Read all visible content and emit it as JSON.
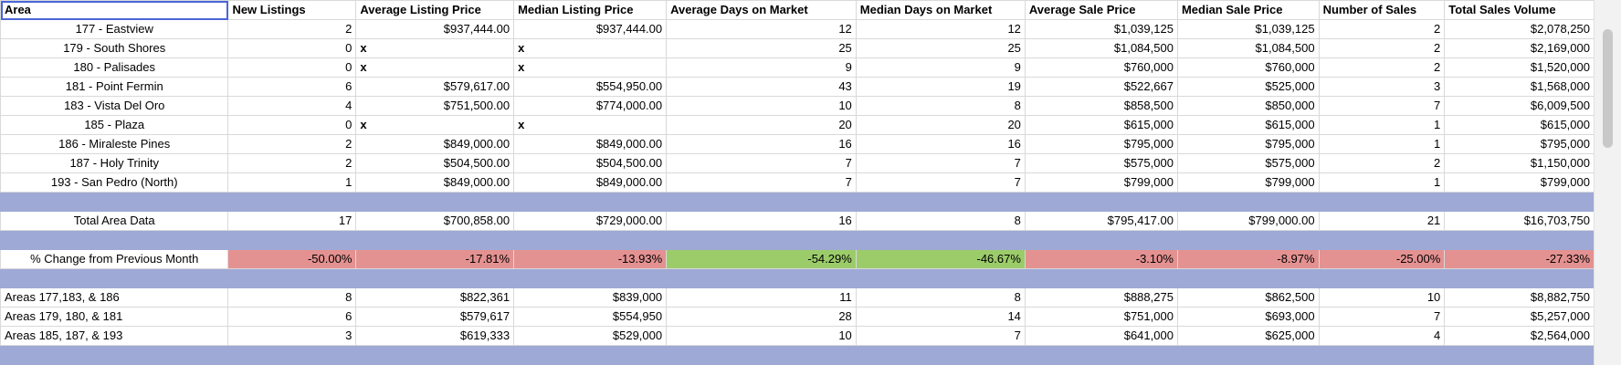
{
  "headers": [
    "Area",
    "New Listings",
    "Average Listing Price",
    "Median Listing Price",
    "Average Days on Market",
    "Median Days on Market",
    "Average Sale Price",
    "Median Sale Price",
    "Number of Sales",
    "Total Sales Volume"
  ],
  "rows": [
    {
      "area": "177 - Eastview",
      "new": "2",
      "avg_list": "$937,444.00",
      "avg_list_x": "",
      "med_list": "$937,444.00",
      "med_list_x": "",
      "avg_dom": "12",
      "med_dom": "12",
      "avg_sale": "$1,039,125",
      "med_sale": "$1,039,125",
      "num": "2",
      "vol": "$2,078,250"
    },
    {
      "area": "179 - South Shores",
      "new": "0",
      "avg_list": "",
      "avg_list_x": "x",
      "med_list": "",
      "med_list_x": "x",
      "avg_dom": "25",
      "med_dom": "25",
      "avg_sale": "$1,084,500",
      "med_sale": "$1,084,500",
      "num": "2",
      "vol": "$2,169,000"
    },
    {
      "area": "180 - Palisades",
      "new": "0",
      "avg_list": "",
      "avg_list_x": "x",
      "med_list": "",
      "med_list_x": "x",
      "avg_dom": "9",
      "med_dom": "9",
      "avg_sale": "$760,000",
      "med_sale": "$760,000",
      "num": "2",
      "vol": "$1,520,000"
    },
    {
      "area": "181 - Point Fermin",
      "new": "6",
      "avg_list": "$579,617.00",
      "avg_list_x": "",
      "med_list": "$554,950.00",
      "med_list_x": "",
      "avg_dom": "43",
      "med_dom": "19",
      "avg_sale": "$522,667",
      "med_sale": "$525,000",
      "num": "3",
      "vol": "$1,568,000"
    },
    {
      "area": "183 - Vista Del Oro",
      "new": "4",
      "avg_list": "$751,500.00",
      "avg_list_x": "",
      "med_list": "$774,000.00",
      "med_list_x": "",
      "avg_dom": "10",
      "med_dom": "8",
      "avg_sale": "$858,500",
      "med_sale": "$850,000",
      "num": "7",
      "vol": "$6,009,500"
    },
    {
      "area": "185 - Plaza",
      "new": "0",
      "avg_list": "",
      "avg_list_x": "x",
      "med_list": "",
      "med_list_x": "x",
      "avg_dom": "20",
      "med_dom": "20",
      "avg_sale": "$615,000",
      "med_sale": "$615,000",
      "num": "1",
      "vol": "$615,000"
    },
    {
      "area": "186 - Miraleste Pines",
      "new": "2",
      "avg_list": "$849,000.00",
      "avg_list_x": "",
      "med_list": "$849,000.00",
      "med_list_x": "",
      "avg_dom": "16",
      "med_dom": "16",
      "avg_sale": "$795,000",
      "med_sale": "$795,000",
      "num": "1",
      "vol": "$795,000"
    },
    {
      "area": "187 - Holy Trinity",
      "new": "2",
      "avg_list": "$504,500.00",
      "avg_list_x": "",
      "med_list": "$504,500.00",
      "med_list_x": "",
      "avg_dom": "7",
      "med_dom": "7",
      "avg_sale": "$575,000",
      "med_sale": "$575,000",
      "num": "2",
      "vol": "$1,150,000"
    },
    {
      "area": "193 - San Pedro (North)",
      "new": "1",
      "avg_list": "$849,000.00",
      "avg_list_x": "",
      "med_list": "$849,000.00",
      "med_list_x": "",
      "avg_dom": "7",
      "med_dom": "7",
      "avg_sale": "$799,000",
      "med_sale": "$799,000",
      "num": "1",
      "vol": "$799,000"
    }
  ],
  "total": {
    "label": "Total Area Data",
    "new": "17",
    "avg_list": "$700,858.00",
    "med_list": "$729,000.00",
    "avg_dom": "16",
    "med_dom": "8",
    "avg_sale": "$795,417.00",
    "med_sale": "$799,000.00",
    "num": "21",
    "vol": "$16,703,750"
  },
  "change": {
    "label": "% Change from Previous Month",
    "new": "-50.00%",
    "avg_list": "-17.81%",
    "med_list": "-13.93%",
    "avg_dom": "-54.29%",
    "med_dom": "-46.67%",
    "avg_sale": "-3.10%",
    "med_sale": "-8.97%",
    "num": "-25.00%",
    "vol": "-27.33%"
  },
  "groups": [
    {
      "area": "Areas 177,183, & 186",
      "new": "8",
      "avg_list": "$822,361",
      "med_list": "$839,000",
      "avg_dom": "11",
      "med_dom": "8",
      "avg_sale": "$888,275",
      "med_sale": "$862,500",
      "num": "10",
      "vol": "$8,882,750"
    },
    {
      "area": "Areas 179, 180, & 181",
      "new": "6",
      "avg_list": "$579,617",
      "med_list": "$554,950",
      "avg_dom": "28",
      "med_dom": "14",
      "avg_sale": "$751,000",
      "med_sale": "$693,000",
      "num": "7",
      "vol": "$5,257,000"
    },
    {
      "area": "Areas 185, 187, & 193",
      "new": "3",
      "avg_list": "$619,333",
      "med_list": "$529,000",
      "avg_dom": "10",
      "med_dom": "7",
      "avg_sale": "$641,000",
      "med_sale": "$625,000",
      "num": "4",
      "vol": "$2,564,000"
    }
  ],
  "colors": {
    "band": "#9ea9d6",
    "negative": "#e49191",
    "positive": "#9ccc6a",
    "selection": "#4a66d8"
  }
}
